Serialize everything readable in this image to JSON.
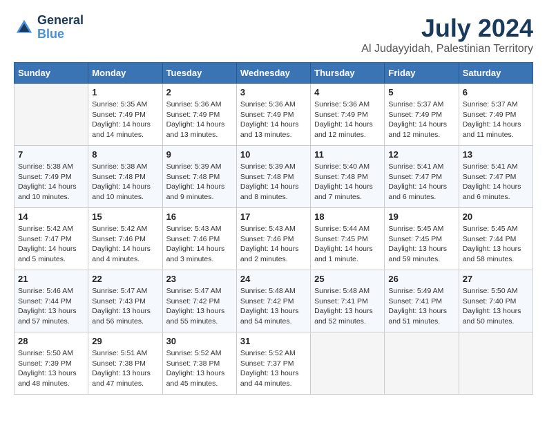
{
  "header": {
    "logo_line1": "General",
    "logo_line2": "Blue",
    "month": "July 2024",
    "location": "Al Judayyidah, Palestinian Territory"
  },
  "days_of_week": [
    "Sunday",
    "Monday",
    "Tuesday",
    "Wednesday",
    "Thursday",
    "Friday",
    "Saturday"
  ],
  "weeks": [
    [
      {
        "day": "",
        "info": ""
      },
      {
        "day": "1",
        "info": "Sunrise: 5:35 AM\nSunset: 7:49 PM\nDaylight: 14 hours\nand 14 minutes."
      },
      {
        "day": "2",
        "info": "Sunrise: 5:36 AM\nSunset: 7:49 PM\nDaylight: 14 hours\nand 13 minutes."
      },
      {
        "day": "3",
        "info": "Sunrise: 5:36 AM\nSunset: 7:49 PM\nDaylight: 14 hours\nand 13 minutes."
      },
      {
        "day": "4",
        "info": "Sunrise: 5:36 AM\nSunset: 7:49 PM\nDaylight: 14 hours\nand 12 minutes."
      },
      {
        "day": "5",
        "info": "Sunrise: 5:37 AM\nSunset: 7:49 PM\nDaylight: 14 hours\nand 12 minutes."
      },
      {
        "day": "6",
        "info": "Sunrise: 5:37 AM\nSunset: 7:49 PM\nDaylight: 14 hours\nand 11 minutes."
      }
    ],
    [
      {
        "day": "7",
        "info": "Sunrise: 5:38 AM\nSunset: 7:49 PM\nDaylight: 14 hours\nand 10 minutes."
      },
      {
        "day": "8",
        "info": "Sunrise: 5:38 AM\nSunset: 7:48 PM\nDaylight: 14 hours\nand 10 minutes."
      },
      {
        "day": "9",
        "info": "Sunrise: 5:39 AM\nSunset: 7:48 PM\nDaylight: 14 hours\nand 9 minutes."
      },
      {
        "day": "10",
        "info": "Sunrise: 5:39 AM\nSunset: 7:48 PM\nDaylight: 14 hours\nand 8 minutes."
      },
      {
        "day": "11",
        "info": "Sunrise: 5:40 AM\nSunset: 7:48 PM\nDaylight: 14 hours\nand 7 minutes."
      },
      {
        "day": "12",
        "info": "Sunrise: 5:41 AM\nSunset: 7:47 PM\nDaylight: 14 hours\nand 6 minutes."
      },
      {
        "day": "13",
        "info": "Sunrise: 5:41 AM\nSunset: 7:47 PM\nDaylight: 14 hours\nand 6 minutes."
      }
    ],
    [
      {
        "day": "14",
        "info": "Sunrise: 5:42 AM\nSunset: 7:47 PM\nDaylight: 14 hours\nand 5 minutes."
      },
      {
        "day": "15",
        "info": "Sunrise: 5:42 AM\nSunset: 7:46 PM\nDaylight: 14 hours\nand 4 minutes."
      },
      {
        "day": "16",
        "info": "Sunrise: 5:43 AM\nSunset: 7:46 PM\nDaylight: 14 hours\nand 3 minutes."
      },
      {
        "day": "17",
        "info": "Sunrise: 5:43 AM\nSunset: 7:46 PM\nDaylight: 14 hours\nand 2 minutes."
      },
      {
        "day": "18",
        "info": "Sunrise: 5:44 AM\nSunset: 7:45 PM\nDaylight: 14 hours\nand 1 minute."
      },
      {
        "day": "19",
        "info": "Sunrise: 5:45 AM\nSunset: 7:45 PM\nDaylight: 13 hours\nand 59 minutes."
      },
      {
        "day": "20",
        "info": "Sunrise: 5:45 AM\nSunset: 7:44 PM\nDaylight: 13 hours\nand 58 minutes."
      }
    ],
    [
      {
        "day": "21",
        "info": "Sunrise: 5:46 AM\nSunset: 7:44 PM\nDaylight: 13 hours\nand 57 minutes."
      },
      {
        "day": "22",
        "info": "Sunrise: 5:47 AM\nSunset: 7:43 PM\nDaylight: 13 hours\nand 56 minutes."
      },
      {
        "day": "23",
        "info": "Sunrise: 5:47 AM\nSunset: 7:42 PM\nDaylight: 13 hours\nand 55 minutes."
      },
      {
        "day": "24",
        "info": "Sunrise: 5:48 AM\nSunset: 7:42 PM\nDaylight: 13 hours\nand 54 minutes."
      },
      {
        "day": "25",
        "info": "Sunrise: 5:48 AM\nSunset: 7:41 PM\nDaylight: 13 hours\nand 52 minutes."
      },
      {
        "day": "26",
        "info": "Sunrise: 5:49 AM\nSunset: 7:41 PM\nDaylight: 13 hours\nand 51 minutes."
      },
      {
        "day": "27",
        "info": "Sunrise: 5:50 AM\nSunset: 7:40 PM\nDaylight: 13 hours\nand 50 minutes."
      }
    ],
    [
      {
        "day": "28",
        "info": "Sunrise: 5:50 AM\nSunset: 7:39 PM\nDaylight: 13 hours\nand 48 minutes."
      },
      {
        "day": "29",
        "info": "Sunrise: 5:51 AM\nSunset: 7:38 PM\nDaylight: 13 hours\nand 47 minutes."
      },
      {
        "day": "30",
        "info": "Sunrise: 5:52 AM\nSunset: 7:38 PM\nDaylight: 13 hours\nand 45 minutes."
      },
      {
        "day": "31",
        "info": "Sunrise: 5:52 AM\nSunset: 7:37 PM\nDaylight: 13 hours\nand 44 minutes."
      },
      {
        "day": "",
        "info": ""
      },
      {
        "day": "",
        "info": ""
      },
      {
        "day": "",
        "info": ""
      }
    ]
  ]
}
